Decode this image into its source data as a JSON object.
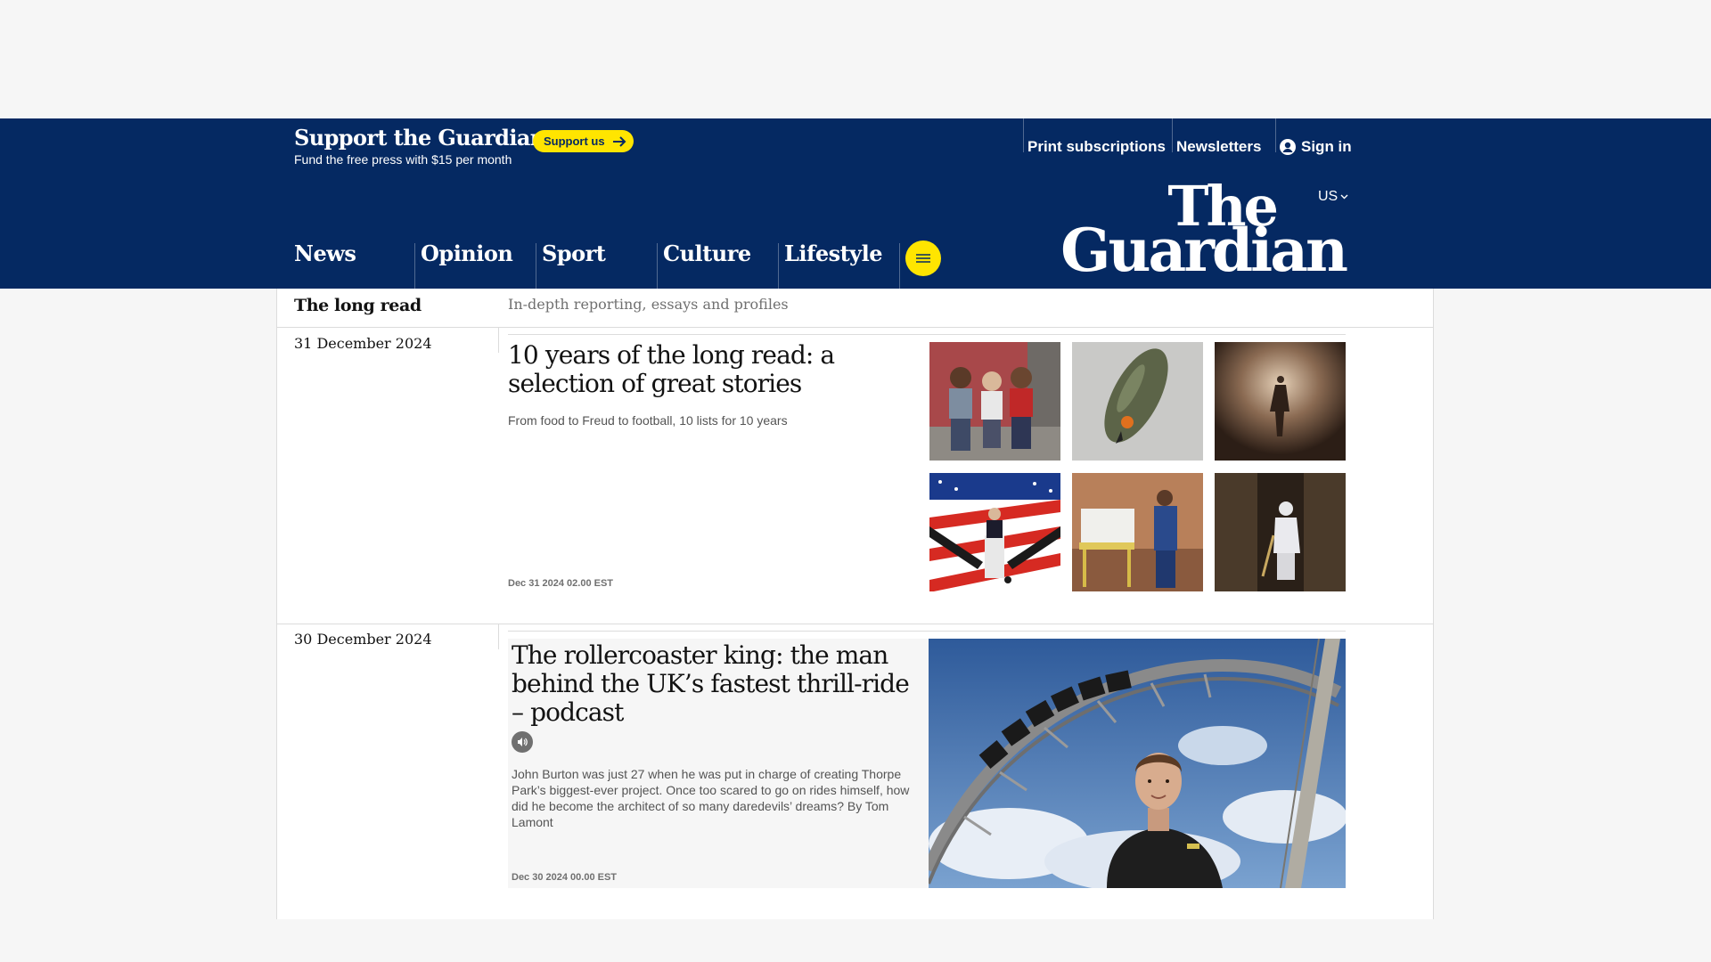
{
  "support": {
    "title": "Support the Guardian",
    "subtitle": "Fund the free press with $15 per month",
    "button": "Support us"
  },
  "top_links": {
    "print": "Print subscriptions",
    "newsletters": "Newsletters",
    "signin": "Sign in"
  },
  "edition": "US",
  "logo": {
    "line1": "The",
    "line2": "Guardian"
  },
  "pillars": [
    "News",
    "Opinion",
    "Sport",
    "Culture",
    "Lifestyle"
  ],
  "section": {
    "title": "The long read",
    "description": "In-depth reporting, essays and profiles"
  },
  "days": [
    {
      "date": "31 December 2024",
      "headline": "10 years of the long read: a selection of great stories",
      "standfirst": "From food to Freud to football, 10 lists for 10 years",
      "timestamp": "Dec 31 2024 02.00 EST"
    },
    {
      "date": "30 December 2024",
      "headline": "The rollercoaster king: the man behind the UK’s fastest thrill-ride – podcast",
      "standfirst": "John Burton was just 27 when he was put in charge of creating Thorpe Park’s biggest-ever project. Once too scared to go on rides himself, how did he become the architect of so many daredevils’ dreams? By Tom Lamont",
      "timestamp": "Dec 30 2024 00.00 EST"
    }
  ],
  "colors": {
    "brand": "#052962",
    "accent": "#ffe500",
    "text": "#121212"
  }
}
